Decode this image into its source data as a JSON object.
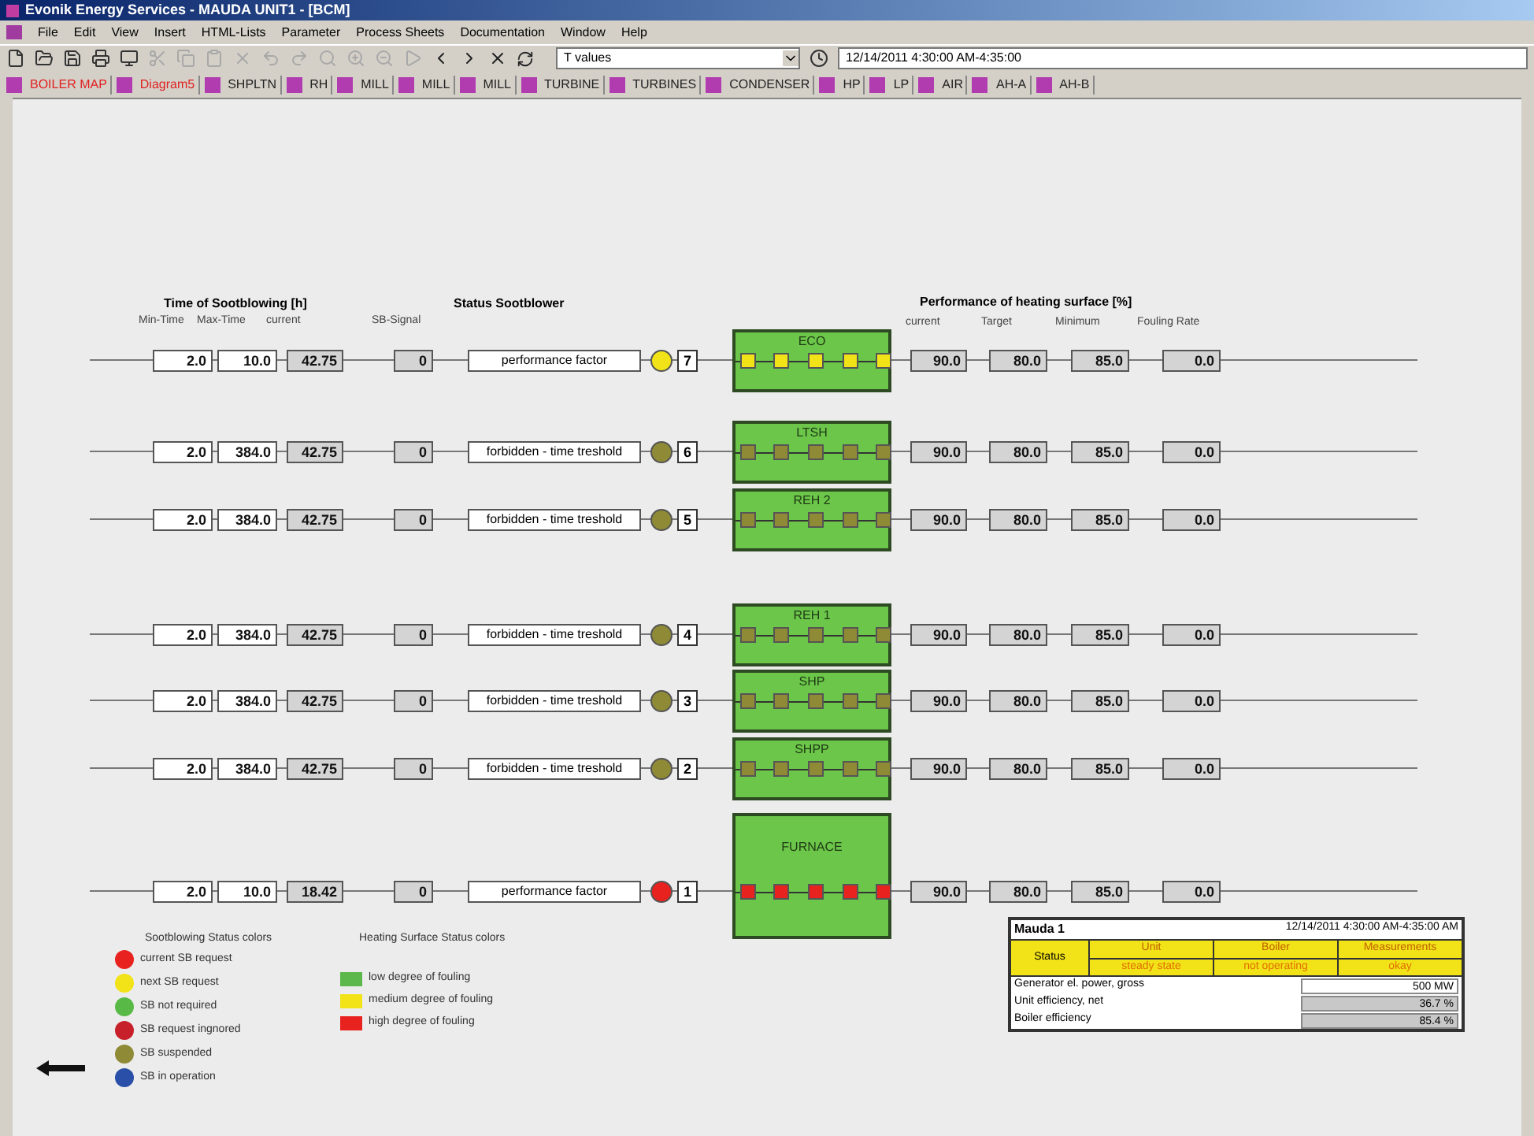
{
  "window": {
    "title": "Evonik Energy Services - MAUDA UNIT1 - [BCM]"
  },
  "menu": [
    "File",
    "Edit",
    "View",
    "Insert",
    "HTML-Lists",
    "Parameter",
    "Process Sheets",
    "Documentation",
    "Window",
    "Help"
  ],
  "toolbar": {
    "values_combo": "T values",
    "time_range": "12/14/2011 4:30:00 AM-4:35:00"
  },
  "tabs": [
    {
      "label": "BOILER MAP",
      "highlighted": true
    },
    {
      "label": "Diagram5",
      "highlighted": true
    },
    {
      "label": "SHPLTN",
      "highlighted": false
    },
    {
      "label": "RH",
      "highlighted": false
    },
    {
      "label": "MILL",
      "highlighted": false
    },
    {
      "label": "MILL",
      "highlighted": false
    },
    {
      "label": "MILL",
      "highlighted": false
    },
    {
      "label": "TURBINE",
      "highlighted": false
    },
    {
      "label": "TURBINES",
      "highlighted": false
    },
    {
      "label": "CONDENSER",
      "highlighted": false
    },
    {
      "label": "HP",
      "highlighted": false
    },
    {
      "label": "LP",
      "highlighted": false
    },
    {
      "label": "AIR",
      "highlighted": false
    },
    {
      "label": "AH-A",
      "highlighted": false
    },
    {
      "label": "AH-B",
      "highlighted": false
    }
  ],
  "headers": {
    "time_title": "Time of Sootblowing [h]",
    "time_columns": [
      "Min-Time",
      "Max-Time",
      "current"
    ],
    "signal": "SB-Signal",
    "status_title": "Status Sootblower",
    "perf_title": "Performance of heating surface [%]",
    "perf_columns": [
      "current",
      "Target",
      "Minimum",
      "Fouling Rate"
    ]
  },
  "rows": [
    {
      "min": "2.0",
      "max": "10.0",
      "current": "42.75",
      "signal": "0",
      "status": "performance factor",
      "color": "#f2e318",
      "number": "7",
      "surface": {
        "label": "ECO",
        "color": "#f2e318"
      },
      "perf": [
        "90.0",
        "80.0",
        "85.0",
        "0.0"
      ]
    },
    {
      "min": "2.0",
      "max": "384.0",
      "current": "42.75",
      "signal": "0",
      "status": "forbidden - time treshold",
      "color": "#8f8a35",
      "number": "6",
      "surface": {
        "label": "LTSH",
        "color": "#8f8a35"
      },
      "perf": [
        "90.0",
        "80.0",
        "85.0",
        "0.0"
      ]
    },
    {
      "min": "2.0",
      "max": "384.0",
      "current": "42.75",
      "signal": "0",
      "status": "forbidden - time treshold",
      "color": "#8f8a35",
      "number": "5",
      "surface": {
        "label": "REH 2",
        "color": "#8f8a35"
      },
      "perf": [
        "90.0",
        "80.0",
        "85.0",
        "0.0"
      ]
    },
    {
      "min": "2.0",
      "max": "384.0",
      "current": "42.75",
      "signal": "0",
      "status": "forbidden - time treshold",
      "color": "#8f8a35",
      "number": "4",
      "surface": {
        "label": "REH 1",
        "color": "#8f8a35"
      },
      "perf": [
        "90.0",
        "80.0",
        "85.0",
        "0.0"
      ]
    },
    {
      "min": "2.0",
      "max": "384.0",
      "current": "42.75",
      "signal": "0",
      "status": "forbidden - time treshold",
      "color": "#8f8a35",
      "number": "3",
      "surface": {
        "label": "SHP",
        "color": "#8f8a35"
      },
      "perf": [
        "90.0",
        "80.0",
        "85.0",
        "0.0"
      ]
    },
    {
      "min": "2.0",
      "max": "384.0",
      "current": "42.75",
      "signal": "0",
      "status": "forbidden - time treshold",
      "color": "#8f8a35",
      "number": "2",
      "surface": {
        "label": "SHPP",
        "color": "#8f8a35"
      },
      "perf": [
        "90.0",
        "80.0",
        "85.0",
        "0.0"
      ]
    },
    {
      "min": "2.0",
      "max": "10.0",
      "current": "18.42",
      "signal": "0",
      "status": "performance factor",
      "color": "#e8231f",
      "number": "1",
      "surface": {
        "label": "FURNACE",
        "color": "#e8231f"
      },
      "perf": [
        "90.0",
        "80.0",
        "85.0",
        "0.0"
      ]
    }
  ],
  "sb_legend": {
    "title": "Sootblowing Status colors",
    "items": [
      {
        "label": "current SB request",
        "color": "#e8231f"
      },
      {
        "label": "next SB request",
        "color": "#f2e318"
      },
      {
        "label": "SB not required",
        "color": "#58b947"
      },
      {
        "label": "SB request ingnored",
        "color": "#c8202a"
      },
      {
        "label": "SB suspended",
        "color": "#8f8a35"
      },
      {
        "label": "SB in operation",
        "color": "#2a4fa8"
      }
    ]
  },
  "surface_legend": {
    "title": "Heating Surface Status colors",
    "items": [
      {
        "label": "low degree of fouling",
        "color": "#5cb84a"
      },
      {
        "label": "medium degree of fouling",
        "color": "#f2e318"
      },
      {
        "label": "high degree of fouling",
        "color": "#e8231f"
      }
    ]
  },
  "info": {
    "unit": "Mauda 1",
    "period": "12/14/2011 4:30:00 AM-4:35:00 AM",
    "status_label": "Status",
    "status": [
      {
        "label": "Unit",
        "value": "steady state"
      },
      {
        "label": "Boiler",
        "value": "not operating"
      },
      {
        "label": "Measurements",
        "value": "okay"
      }
    ],
    "values": [
      {
        "label": "Generator el. power, gross",
        "value": "500 MW",
        "kind": "plain"
      },
      {
        "label": "Unit efficiency, net",
        "value": "36.7 %",
        "kind": "grey"
      },
      {
        "label": "Boiler efficiency",
        "value": "85.4 %",
        "kind": "grey"
      }
    ]
  }
}
